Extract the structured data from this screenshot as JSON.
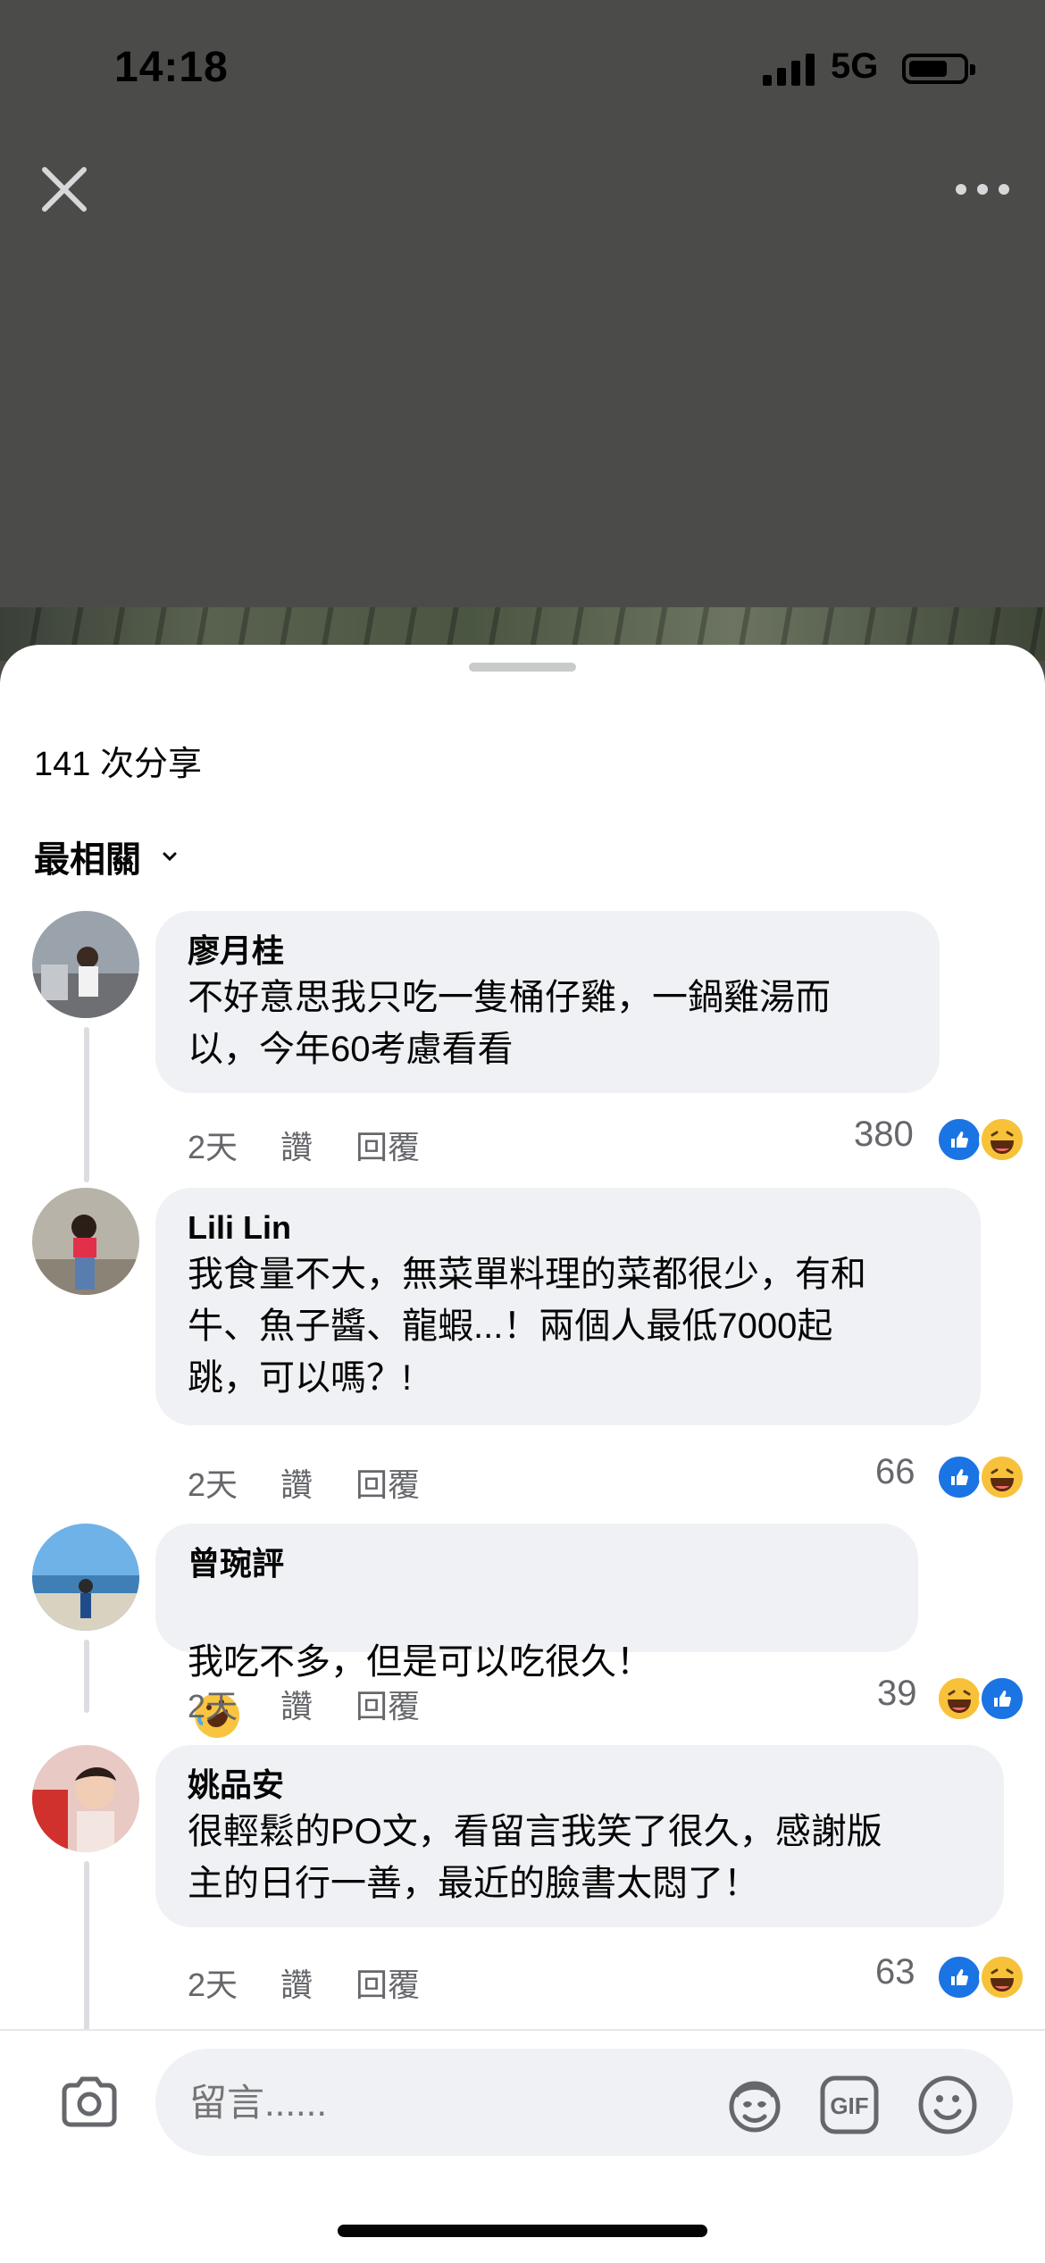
{
  "status_bar": {
    "time": "14:18",
    "network": "5G"
  },
  "sheet": {
    "shares_label": "141 次分享",
    "sort_label": "最相關"
  },
  "comments": [
    {
      "name": "廖月桂",
      "text": "不好意思我只吃一隻桶仔雞，一鍋雞湯而\n以，今年60考慮看看",
      "time": "2天",
      "like": "讚",
      "reply": "回覆",
      "count": "380",
      "reactions": [
        "like-icon",
        "haha-icon"
      ]
    },
    {
      "name": "Lili Lin",
      "text": "我食量不大，無菜單料理的菜都很少，有和\n牛、魚子醬、龍蝦...！兩個人最低7000起\n跳，可以嗎？!",
      "time": "2天",
      "like": "讚",
      "reply": "回覆",
      "count": "66",
      "reactions": [
        "like-icon",
        "haha-icon"
      ]
    },
    {
      "name": "曾琬評",
      "text": "我吃不多，但是可以吃很久！",
      "time": "2天",
      "like": "讚",
      "reply": "回覆",
      "count": "39",
      "reactions": [
        "haha-icon",
        "like-icon"
      ]
    },
    {
      "name": "姚品安",
      "text": "很輕鬆的PO文，看留言我笑了很久，感謝版\n主的日行一善，最近的臉書太悶了！",
      "time": "2天",
      "like": "讚",
      "reply": "回覆",
      "count": "63",
      "reactions": [
        "like-icon",
        "haha-icon"
      ]
    }
  ],
  "composer": {
    "placeholder": "留言......",
    "gif_label": "GIF"
  },
  "colors": {
    "accent": "#1b74e4",
    "bubble": "#f0f1f4",
    "dim_bg": "#4b4c4a"
  }
}
